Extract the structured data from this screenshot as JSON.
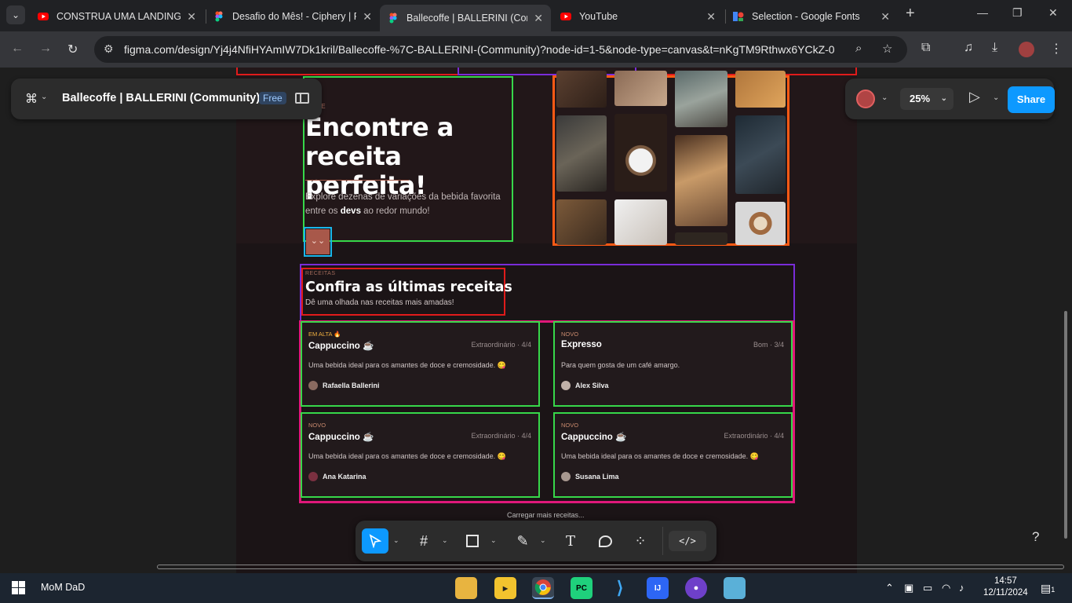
{
  "browser": {
    "tabs": [
      {
        "title": "CONSTRUA UMA LANDING",
        "icon": "youtube-icon",
        "active": false
      },
      {
        "title": "Desafio do Mês! - Ciphery | F",
        "icon": "figma-icon",
        "active": false
      },
      {
        "title": "Ballecoffe | BALLERINI (Comm",
        "icon": "figma-icon",
        "active": true
      },
      {
        "title": "YouTube",
        "icon": "youtube-icon",
        "active": false
      },
      {
        "title": "Selection - Google Fonts",
        "icon": "google-fonts-icon",
        "active": false
      }
    ],
    "url": "figma.com/design/Yj4j4NfiHYAmIW7Dk1kril/Ballecoffe-%7C-BALLERINI-(Community)?node-id=1-5&node-type=canvas&t=nKgTM9Rthwx6YCkZ-0"
  },
  "figma": {
    "file_name": "Ballecoffe | BALLERINI (Community)",
    "plan_badge": "Free",
    "zoom": "25%",
    "share_label": "Share",
    "help_label": "?"
  },
  "design": {
    "hero": {
      "kicker": "...ADE",
      "title": "Encontre a receita perfeita!",
      "desc_before": "Explore dezenas de variações da bebida favorita entre os ",
      "desc_bold": "devs",
      "desc_after": " ao redor mundo!",
      "button_glyph": "⌄⌄"
    },
    "section": {
      "kicker": "RECEITAS",
      "title": "Confira as últimas receitas",
      "subtitle": "Dê uma olhada nas receitas mais amadas!"
    },
    "cards": [
      {
        "tag": "EM ALTA 🔥",
        "title": "Cappuccino ☕",
        "rating": "Extraordinário · 4/4",
        "desc": "Uma bebida ideal para os amantes de doce e cremosidade. 😋",
        "author": "Rafaella Ballerini"
      },
      {
        "tag": "NOVO",
        "title": "Expresso",
        "rating": "Bom · 3/4",
        "desc": "Para quem gosta de um café amargo.",
        "author": "Alex Silva"
      },
      {
        "tag": "NOVO",
        "title": "Cappuccino ☕",
        "rating": "Extraordinário · 4/4",
        "desc": "Uma bebida ideal para os amantes de doce e cremosidade. 😋",
        "author": "Ana Katarina"
      },
      {
        "tag": "NOVO",
        "title": "Cappuccino ☕",
        "rating": "Extraordinário · 4/4",
        "desc": "Uma bebida ideal para os amantes de doce e cremosidade. 😋",
        "author": "Susana Lima"
      }
    ],
    "load_more": "Carregar mais receitas..."
  },
  "taskbar": {
    "user": "MoM  DaD",
    "time": "14:57",
    "date": "12/11/2024",
    "notifications": "1"
  },
  "colors": {
    "figma_blue": "#0d99ff",
    "sel_red": "#e01b1b",
    "sel_green": "#37d84a",
    "sel_purple": "#7a2cd9",
    "sel_orange": "#ff5a14",
    "sel_pink": "#e0187a",
    "sel_cyan": "#19b6ea"
  }
}
